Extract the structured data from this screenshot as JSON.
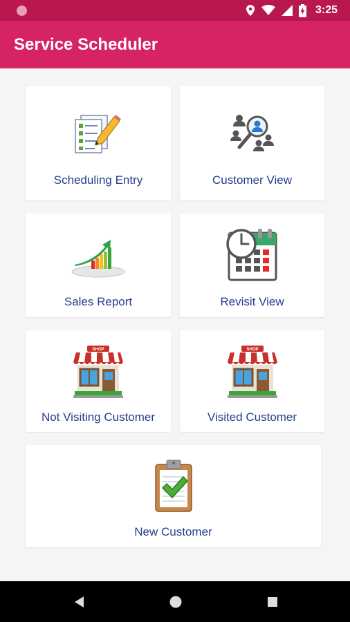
{
  "status_bar": {
    "time": "3:25",
    "icons": [
      "notification-dot-icon",
      "location-icon",
      "wifi-icon",
      "signal-icon",
      "battery-charging-icon"
    ]
  },
  "app_bar": {
    "title": "Service Scheduler",
    "color": "#d62363"
  },
  "menu": {
    "tiles": [
      {
        "label": "Scheduling Entry",
        "icon": "checklist-pencil-icon"
      },
      {
        "label": "Customer View",
        "icon": "customer-search-icon"
      },
      {
        "label": "Sales Report",
        "icon": "growth-chart-icon"
      },
      {
        "label": "Revisit View",
        "icon": "calendar-clock-icon"
      },
      {
        "label": "Not Visiting Customer",
        "icon": "shop-icon"
      },
      {
        "label": "Visited Customer",
        "icon": "shop-icon"
      },
      {
        "label": "New Customer",
        "icon": "clipboard-check-icon"
      }
    ],
    "label_color": "#23408e"
  },
  "nav_bar": {
    "icons": [
      "back-icon",
      "home-icon",
      "recents-icon"
    ]
  }
}
